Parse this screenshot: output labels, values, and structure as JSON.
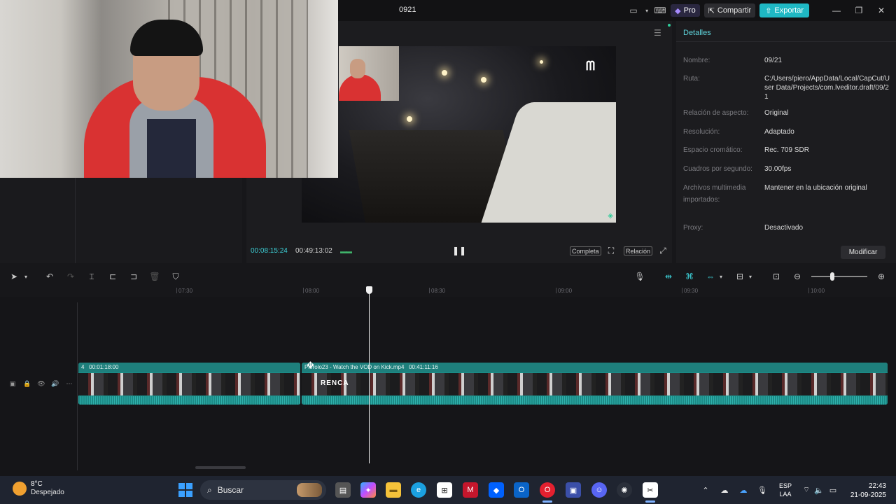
{
  "window": {
    "title": "0921",
    "pro_label": "Pro",
    "share_label": "Compartir",
    "export_label": "Exportar"
  },
  "player": {
    "current_time": "00:08:15:24",
    "total_time": "00:49:13:02",
    "full_label": "Completa",
    "ratio_label": "Relación"
  },
  "details": {
    "tab_label": "Detalles",
    "rows": [
      {
        "key": "Nombre:",
        "value": "09/21"
      },
      {
        "key": "Ruta:",
        "value": "C:/Users/piero/AppData/Local/CapCut/User Data/Projects/com.lveditor.draft/09/21"
      },
      {
        "key": "Relación de aspecto:",
        "value": "Original"
      },
      {
        "key": "Resolución:",
        "value": "Adaptado"
      },
      {
        "key": "Espacio cromático:",
        "value": "Rec. 709 SDR"
      },
      {
        "key": "Cuadros por segundo:",
        "value": "30.00fps"
      },
      {
        "key": "Archivos multimedia importados:",
        "value": "Mantener en la ubicación original"
      },
      {
        "key": "Proxy:",
        "value": "Desactivado"
      }
    ],
    "modify_label": "Modificar"
  },
  "timeline": {
    "ruler": [
      "07:30",
      "08:00",
      "08:30",
      "09:00",
      "09:30",
      "10:00"
    ],
    "clip1": {
      "number": "4",
      "duration": "00:01:18:00"
    },
    "clip2": {
      "name": "Pierolo23 - Watch the VOD on Kick.mp4",
      "duration": "00:41:11:16"
    },
    "overlay_text": "RENCA"
  },
  "taskbar": {
    "temperature": "8°C",
    "condition": "Despejado",
    "search_label": "Buscar",
    "lang_line1": "ESP",
    "lang_line2": "LAA",
    "time": "22:43",
    "date": "21-09-2025"
  },
  "colors": {
    "accent": "#1fb8c4",
    "clip": "#1a8f8a",
    "timecode": "#3ccfd6"
  }
}
